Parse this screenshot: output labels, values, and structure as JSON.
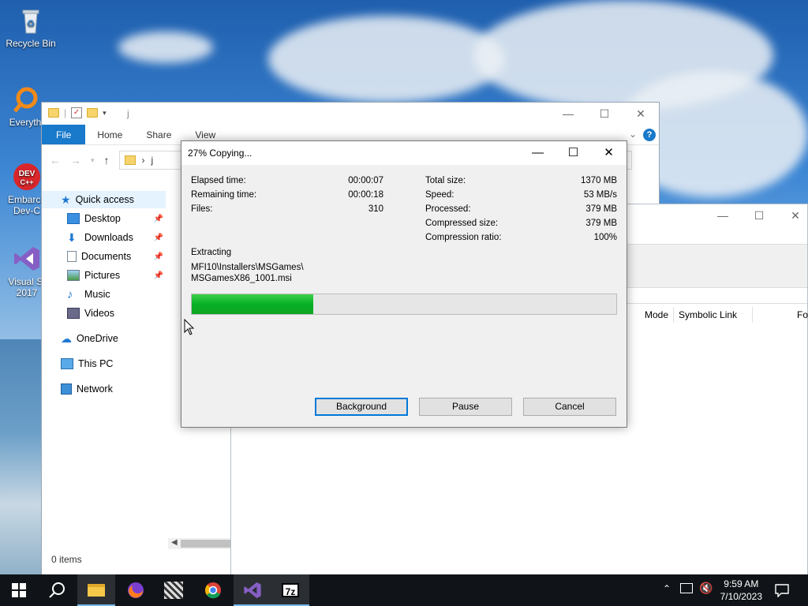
{
  "desktop": {
    "icons": [
      {
        "name": "recycle-bin",
        "label": "Recycle Bin"
      },
      {
        "name": "everything",
        "label": "Everyth"
      },
      {
        "name": "embarcadero-dev-cpp",
        "label": "Embarca Dev-C"
      },
      {
        "name": "visual-studio-2017",
        "label": "Visual St 2017"
      }
    ]
  },
  "explorer": {
    "title": "j",
    "tabs": [
      "File",
      "Home",
      "Share",
      "View"
    ],
    "address": "j",
    "nav": [
      {
        "label": "Quick access",
        "icon": "star-icon",
        "selected": true
      },
      {
        "label": "Desktop",
        "icon": "desktop-icon",
        "pinned": true
      },
      {
        "label": "Downloads",
        "icon": "downloads-icon",
        "pinned": true
      },
      {
        "label": "Documents",
        "icon": "documents-icon",
        "pinned": true
      },
      {
        "label": "Pictures",
        "icon": "pictures-icon",
        "pinned": true
      },
      {
        "label": "Music",
        "icon": "music-icon"
      },
      {
        "label": "Videos",
        "icon": "videos-icon"
      },
      {
        "label": "OneDrive",
        "icon": "cloud-icon"
      },
      {
        "label": "This PC",
        "icon": "computer-icon"
      },
      {
        "label": "Network",
        "icon": "network-icon"
      }
    ],
    "status": "0 items"
  },
  "zip_manager": {
    "columns": [
      "Mode",
      "Symbolic Link",
      "Fo"
    ]
  },
  "progress_dialog": {
    "title": "27% Copying...",
    "left_stats": [
      {
        "label": "Elapsed time:",
        "value": "00:00:07"
      },
      {
        "label": "Remaining time:",
        "value": "00:00:18"
      },
      {
        "label": "Files:",
        "value": "310"
      }
    ],
    "right_stats": [
      {
        "label": "Total size:",
        "value": "1370 MB"
      },
      {
        "label": "Speed:",
        "value": "53 MB/s"
      },
      {
        "label": "Processed:",
        "value": "379 MB"
      },
      {
        "label": "Compressed size:",
        "value": "379 MB"
      },
      {
        "label": "Compression ratio:",
        "value": "100%"
      }
    ],
    "operation": "Extracting",
    "path_line1": "MFI10\\Installers\\MSGames\\",
    "path_line2": "MSGamesX86_1001.msi",
    "progress_fraction": 0.287,
    "buttons": {
      "background": "Background",
      "pause": "Pause",
      "cancel": "Cancel"
    }
  },
  "taskbar": {
    "time": "9:59 AM",
    "date": "7/10/2023",
    "apps": [
      "start",
      "search",
      "file-explorer",
      "firefox",
      "app-icon",
      "chrome",
      "visual-studio",
      "7-zip"
    ]
  }
}
